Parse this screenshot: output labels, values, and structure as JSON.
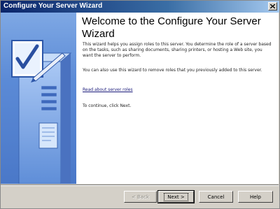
{
  "window": {
    "title": "Configure Your Server Wizard"
  },
  "content": {
    "heading": "Welcome to the Configure Your Server Wizard",
    "paragraph1": "This wizard helps you assign roles to this server. You determine the role of a server based on the tasks, such as sharing documents, sharing printers, or hosting a Web site, you want the server to perform.",
    "paragraph2": "You can also use this wizard to remove roles that you previously added to this server.",
    "link": "Read about server roles",
    "paragraph3": "To continue, click Next."
  },
  "buttons": {
    "back": "< Back",
    "next": "Next >",
    "cancel": "Cancel",
    "help": "Help"
  },
  "colors": {
    "titlebar_start": "#0a246a",
    "sidebar": "#5b8ad6",
    "link": "#1a1a7a"
  },
  "icons": {
    "close": "close-icon",
    "illustration": "server-checklist-illustration"
  }
}
